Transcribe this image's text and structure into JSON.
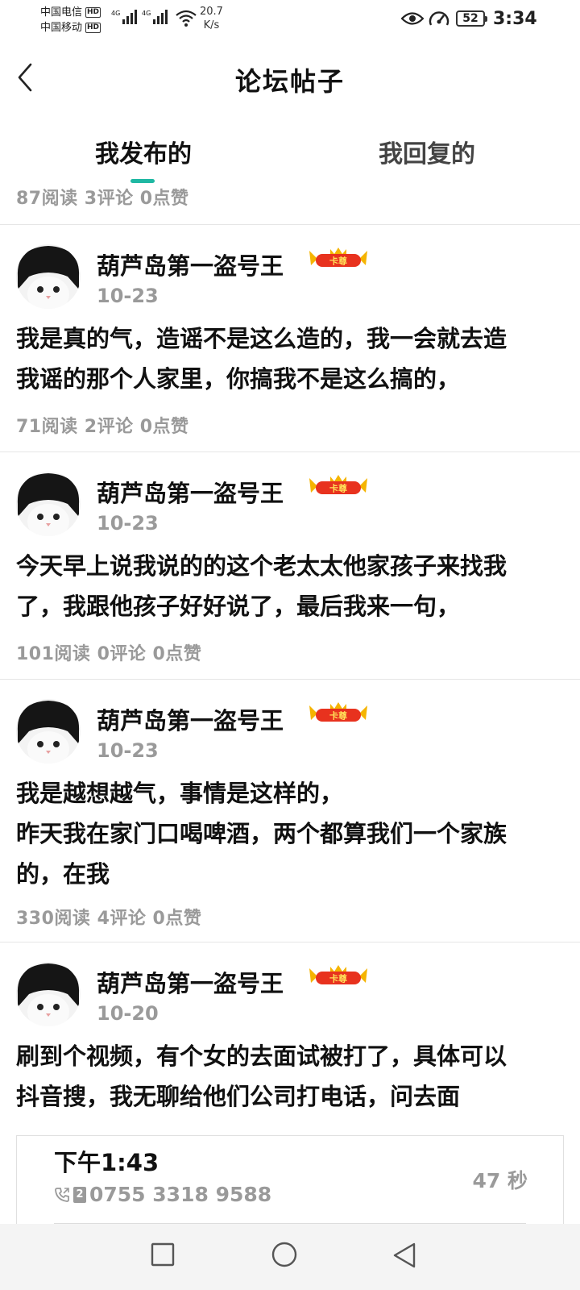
{
  "status_bar": {
    "carrier_1": "中国电信",
    "carrier_2": "中国移动",
    "hd_1": "HD",
    "hd_2": "HD",
    "net_1": "4G",
    "net_2": "4G",
    "speed_value": "20.7",
    "speed_unit": "K/s",
    "battery": "52",
    "time": "3:34"
  },
  "header": {
    "title": "论坛帖子"
  },
  "tabs": [
    {
      "label": "我发布的",
      "active": true
    },
    {
      "label": "我回复的",
      "active": false
    }
  ],
  "top_partial_stats": "87阅读 3评论 0点赞",
  "posts": [
    {
      "username": "葫芦岛第一盗号王",
      "badge": "卡尊",
      "date": "10-23",
      "lines": [
        "我是真的气，造谣不是这么造的，我一会就去造",
        "我谣的那个人家里，你搞我不是这么搞的，"
      ],
      "stats": "71阅读 2评论 0点赞"
    },
    {
      "username": "葫芦岛第一盗号王",
      "badge": "卡尊",
      "date": "10-23",
      "lines": [
        "今天早上说我说的的这个老太太他家孩子来找我",
        "了，我跟他孩子好好说了，最后我来一句，"
      ],
      "stats": "101阅读 0评论 0点赞"
    },
    {
      "username": "葫芦岛第一盗号王",
      "badge": "卡尊",
      "date": "10-23",
      "lines": [
        "我是越想越气，事情是这样的，",
        "昨天我在家门口喝啤酒，两个都算我们一个家族",
        "的，在我"
      ],
      "stats": "330阅读 4评论 0点赞"
    },
    {
      "username": "葫芦岛第一盗号王",
      "badge": "卡尊",
      "date": "10-20",
      "lines": [
        "刷到个视频，有个女的去面试被打了，具体可以",
        "抖音搜，我无聊给他们公司打电话，问去面"
      ],
      "stats": ""
    }
  ],
  "call_card": {
    "time": "下午1:43",
    "sim": "2",
    "number": "0755 3318 9588",
    "duration": "47 秒"
  },
  "colors": {
    "accent": "#1fb8a3",
    "muted_text": "#9a9a9a",
    "divider": "#e6e6e6"
  },
  "icons": [
    "back-arrow-icon",
    "eye-icon",
    "gauge-icon",
    "wifi-icon",
    "crown-badge-icon",
    "phone-icon",
    "sim-icon",
    "square-nav-icon",
    "circle-nav-icon",
    "triangle-nav-icon"
  ]
}
